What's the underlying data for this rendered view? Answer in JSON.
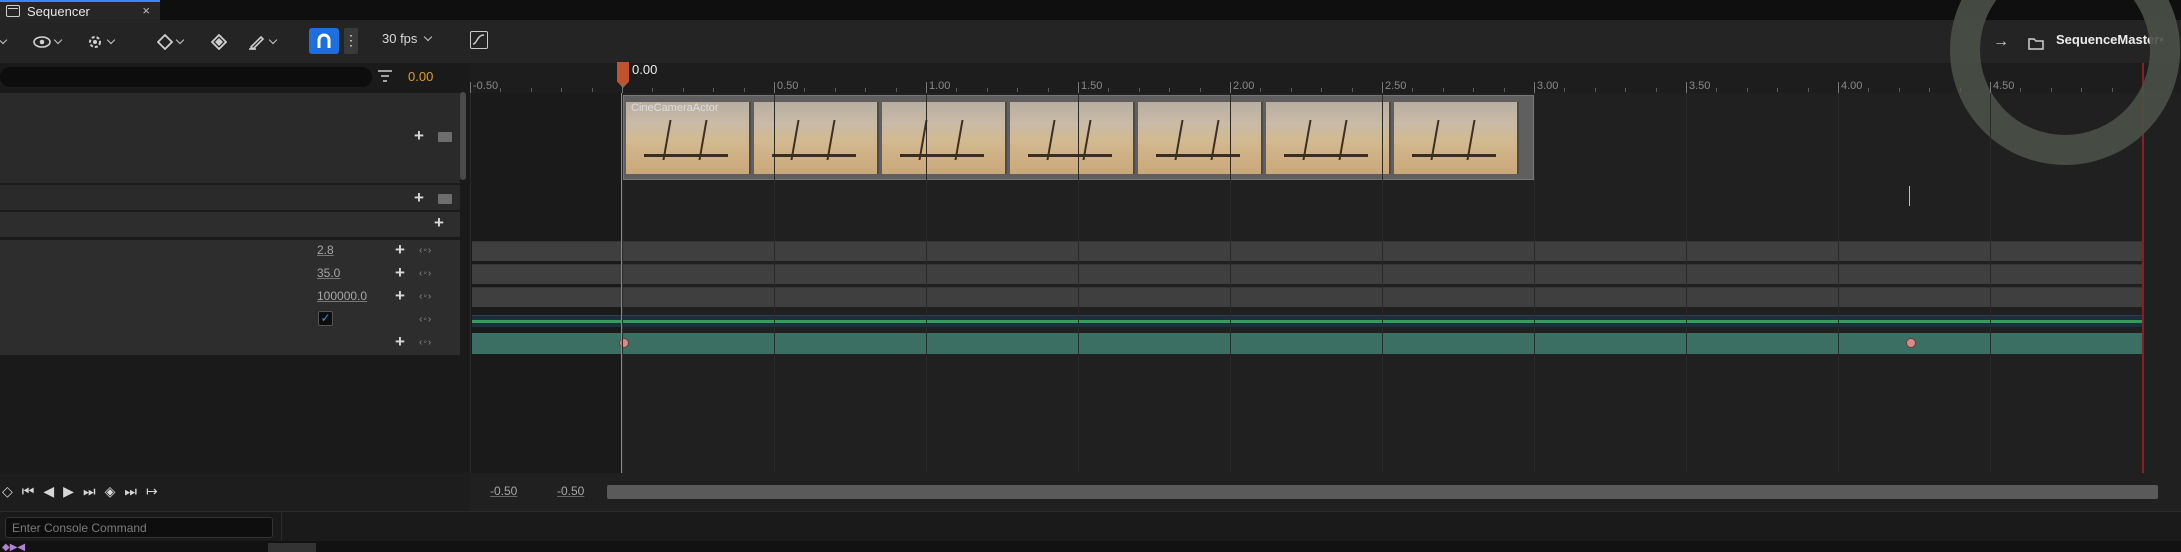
{
  "tab": {
    "title": "Sequencer",
    "close": "×"
  },
  "toolbar": {
    "fps": "30 fps",
    "snap_icon": "magnet-icon",
    "more": "⋮",
    "arrow": "→"
  },
  "sequence": {
    "name": "SequenceMaster•"
  },
  "outliner": {
    "search_placeholder": "",
    "current_time": "0.00"
  },
  "tracks": {
    "camera_actor": "CineCameraActor",
    "properties": [
      {
        "value": "2.8"
      },
      {
        "value": "35.0"
      },
      {
        "value": "100000.0"
      },
      {
        "value": "",
        "checkbox": true
      },
      {
        "value": ""
      }
    ]
  },
  "playhead": {
    "time": "0.00"
  },
  "ruler": {
    "ticks": [
      "-0.50",
      "0.00",
      "0.50",
      "1.00",
      "1.50",
      "2.00",
      "2.50",
      "3.00",
      "3.50",
      "4.00",
      "4.50"
    ]
  },
  "range": {
    "start": "-0.50",
    "end": "-0.50"
  },
  "console": {
    "placeholder": "Enter Console Command"
  },
  "colors": {
    "accent": "#1d6fe0",
    "playhead": "#c2522e",
    "start_marker": "#3fbf4a",
    "end_marker": "#8b1e1e",
    "time_text": "#e39c27",
    "selected_track": "#3b6f63"
  }
}
